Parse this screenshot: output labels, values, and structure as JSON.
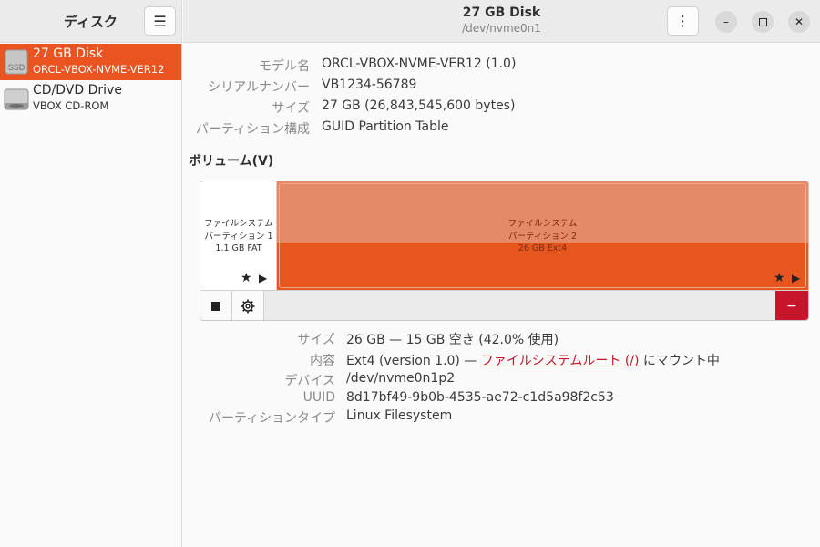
{
  "sidebar": {
    "title": "ディスク",
    "menu_icon": "hamburger-menu-icon",
    "devices": [
      {
        "name": "27 GB Disk",
        "sub": "ORCL-VBOX-NVME-VER12",
        "icon": "ssd-drive-icon",
        "icon_label": "SSD",
        "selected": true
      },
      {
        "name": "CD/DVD Drive",
        "sub": "VBOX CD-ROM",
        "icon": "optical-drive-icon",
        "selected": false
      }
    ]
  },
  "header": {
    "title": "27 GB Disk",
    "subtitle": "/dev/nvme0n1"
  },
  "disk_info": {
    "model_label": "モデル名",
    "model_value": "ORCL-VBOX-NVME-VER12 (1.0)",
    "serial_label": "シリアルナンバー",
    "serial_value": "VB1234-56789",
    "size_label": "サイズ",
    "size_value": "27 GB (26,843,545,600 bytes)",
    "partitioning_label": "パーティション構成",
    "partitioning_value": "GUID Partition Table"
  },
  "volumes": {
    "title": "ボリューム(V)",
    "partitions": [
      {
        "line1": "ファイルシステム",
        "line2": "パーティション 1",
        "line3": "1.1 GB FAT"
      },
      {
        "line1": "ファイルシステム",
        "line2": "パーティション 2",
        "line3": "26 GB Ext4",
        "used_fraction": 0.42
      }
    ]
  },
  "partition_info": {
    "size_label": "サイズ",
    "size_value": "26 GB — 15 GB 空き (42.0% 使用)",
    "contents_label": "内容",
    "contents_prefix": "Ext4 (version 1.0) — ",
    "contents_link": "ファイルシステムルート (/)",
    "contents_suffix": " にマウント中",
    "device_label": "デバイス",
    "device_value": "/dev/nvme0n1p2",
    "uuid_label": "UUID",
    "uuid_value": "8d17bf49-9b0b-4535-ae72-c1d5a98f2c53",
    "ptype_label": "パーティションタイプ",
    "ptype_value": "Linux Filesystem"
  },
  "colors": {
    "accent": "#e95420",
    "delete": "#c7162b"
  }
}
